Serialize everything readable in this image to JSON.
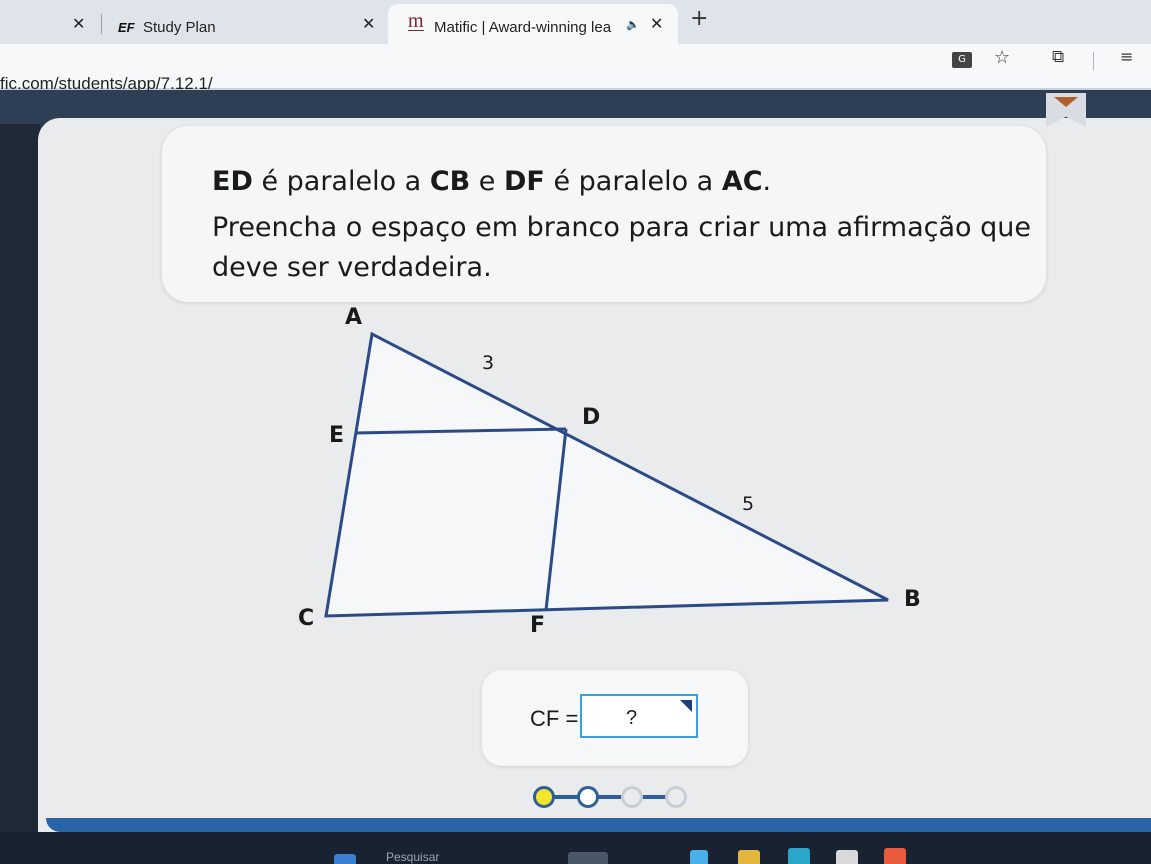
{
  "browser": {
    "tabs": [
      {
        "title": "Study Plan",
        "logo": "EF",
        "active": false
      },
      {
        "title": "Matific | Award-winning lea",
        "logo": "m",
        "active": true
      }
    ],
    "url": "fic.com/students/app/7.12.1/",
    "icons": [
      "close-icon",
      "speaker-icon",
      "plus-icon",
      "translate-icon",
      "star-icon",
      "extensions-icon",
      "reading-list-icon"
    ]
  },
  "question": {
    "line1": {
      "seg1": "ED",
      "seg2": " é paralelo a ",
      "seg3": "CB",
      "seg4": " e ",
      "seg5": "DF",
      "seg6": " é paralelo a ",
      "seg7": "AC",
      "seg8": "."
    },
    "line2": "Preencha o espaço em branco para criar uma afirmação que",
    "line3": "deve ser verdadeira."
  },
  "diagram": {
    "points": {
      "A": "A",
      "E": "E",
      "D": "D",
      "C": "C",
      "F": "F",
      "B": "B"
    },
    "lengths": {
      "AD": "3",
      "DB": "5"
    },
    "line_color": "#2b4a86"
  },
  "answer": {
    "label": "CF =",
    "placeholder": "?",
    "border_color": "#3aa0dc"
  },
  "progress": {
    "total": 4,
    "completed": 1,
    "active_index": 1,
    "colors": {
      "done": "#f3e52a",
      "current": "#ffffff",
      "pending": "#e9ebed",
      "track": "#2e5f99"
    }
  },
  "taskbar": {
    "search_text": "Pesquisar"
  }
}
